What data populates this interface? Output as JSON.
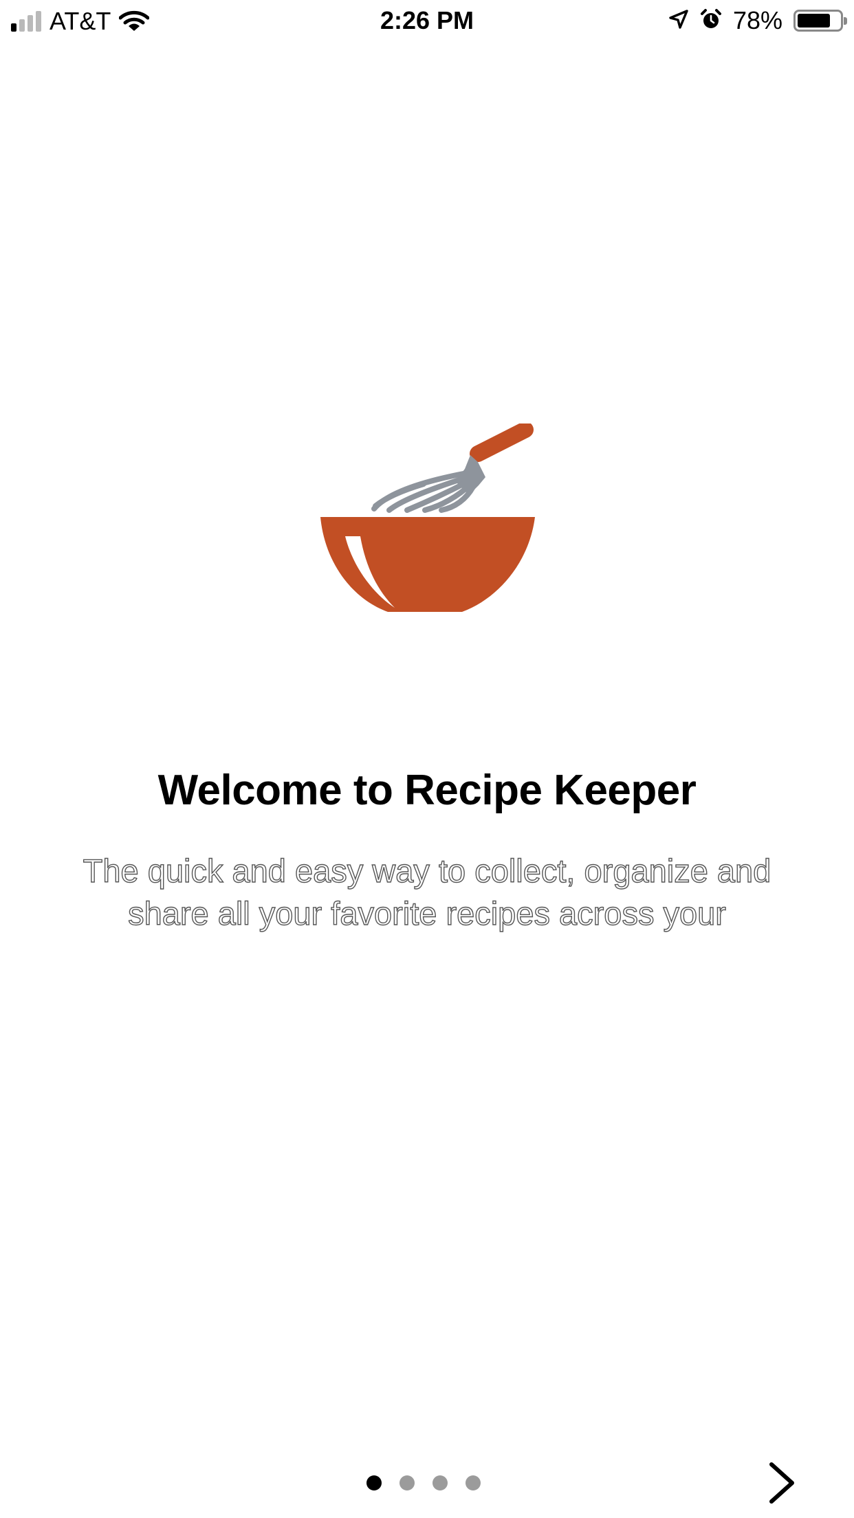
{
  "status_bar": {
    "carrier": "AT&T",
    "time": "2:26 PM",
    "battery_percent": "78%",
    "battery_level": 0.78,
    "signal_bars_active": 1,
    "signal_bars_total": 4,
    "icons": [
      "signal-icon",
      "wifi-icon",
      "location-arrow-icon",
      "alarm-icon",
      "battery-icon"
    ]
  },
  "onboarding": {
    "illustration": "whisk-bowl-logo",
    "title": "Welcome to Recipe Keeper",
    "description": "The quick and easy way to collect, organize and share all your favorite recipes across your",
    "page_count": 4,
    "current_page": 1,
    "next_icon": "chevron-right-icon"
  },
  "colors": {
    "accent": "#c24f24",
    "whisk_gray": "#8e949c",
    "inactive_dot": "#9b9b9b",
    "active_dot": "#000000"
  }
}
